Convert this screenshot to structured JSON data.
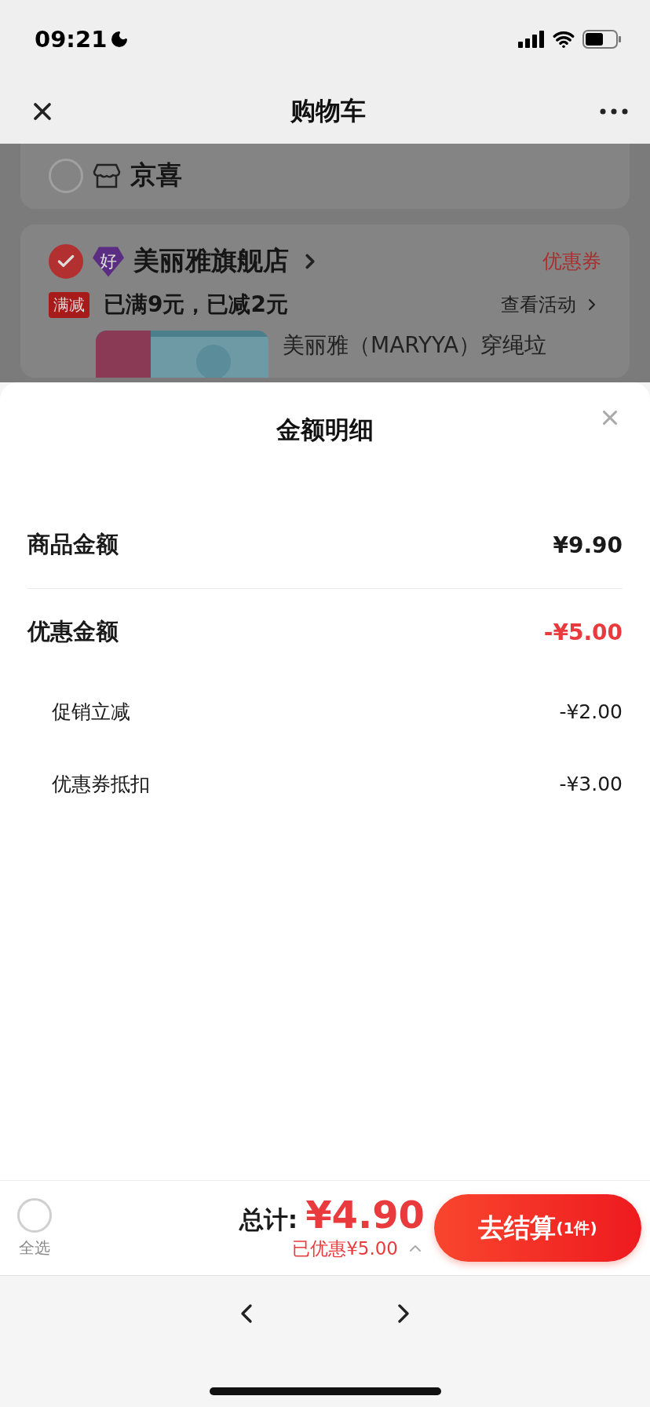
{
  "status_bar": {
    "time": "09:21"
  },
  "nav": {
    "title": "购物车"
  },
  "cart": {
    "stores": [
      {
        "kind": "plain",
        "name": "京喜",
        "selected": false
      },
      {
        "kind": "flagship",
        "badge": "好",
        "name": "美丽雅旗舰店",
        "selected": true,
        "coupon": "优惠券",
        "promo": {
          "tag": "满减",
          "text": "已满9元，已减2元",
          "link": "查看活动"
        },
        "product": {
          "kind": "picture",
          "title": "美丽雅（MARYYA）穿绳垃"
        }
      }
    ]
  },
  "sheet": {
    "title": "金额明细",
    "rows": [
      {
        "kind": "main",
        "label": "商品金额",
        "value": "¥9.90",
        "highlight": false
      },
      {
        "kind": "main",
        "label": "优惠金额",
        "value": "-¥5.00",
        "highlight": true
      },
      {
        "kind": "sub",
        "label": "促销立减",
        "value": "-¥2.00",
        "highlight": false
      },
      {
        "kind": "sub",
        "label": "优惠券抵扣",
        "value": "-¥3.00",
        "highlight": false
      }
    ]
  },
  "footer": {
    "select_all": {
      "label": "全选",
      "checked": false
    },
    "total_label": "总计:",
    "total": "¥4.90",
    "saved": "已优惠¥5.00",
    "checkout": {
      "label": "去结算",
      "count": "(1件)"
    }
  }
}
